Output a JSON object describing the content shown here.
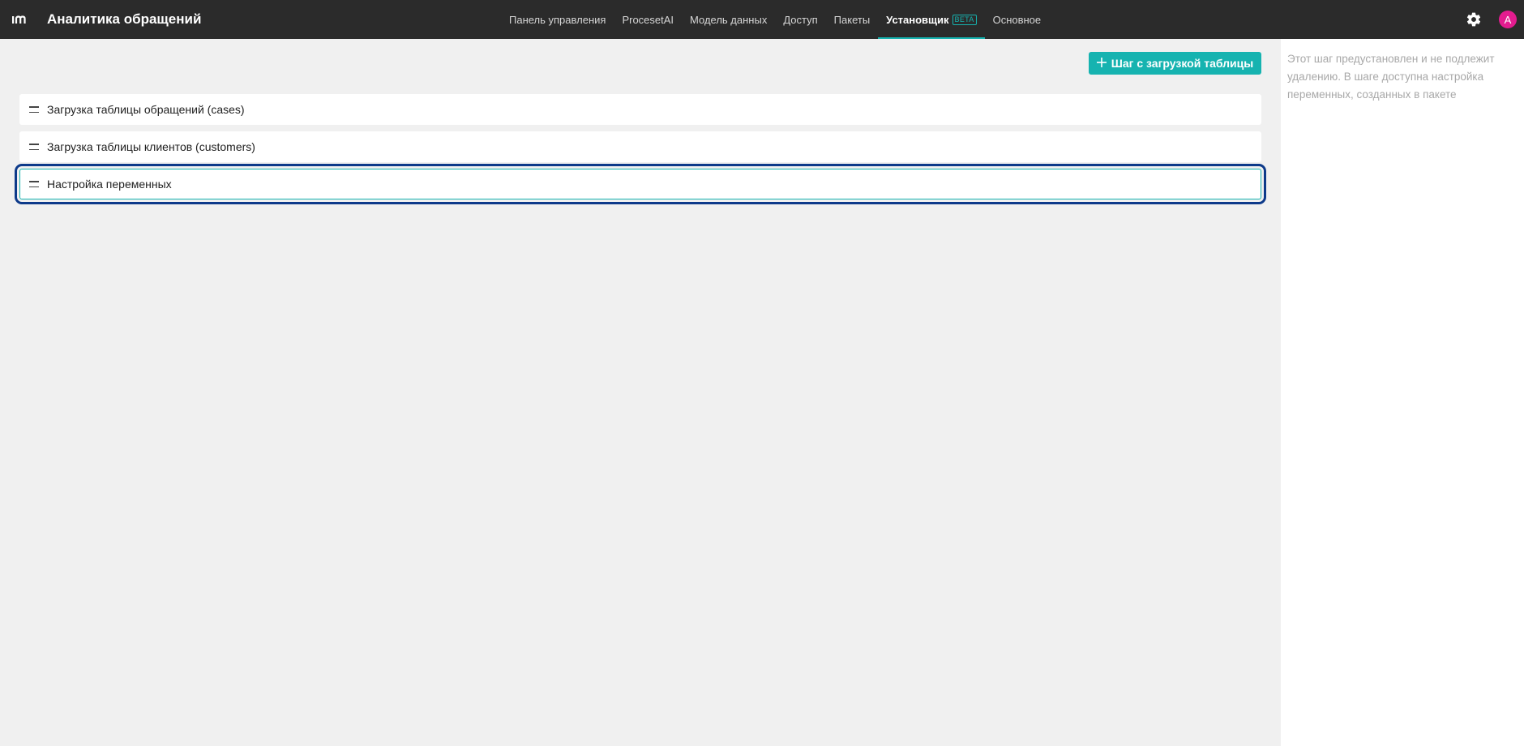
{
  "header": {
    "app_title": "Аналитика обращений",
    "logo_icon": "im-logo-icon",
    "tabs": [
      {
        "label": "Панель управления",
        "active": false
      },
      {
        "label": "ProcesetAI",
        "active": false
      },
      {
        "label": "Модель данных",
        "active": false
      },
      {
        "label": "Доступ",
        "active": false
      },
      {
        "label": "Пакеты",
        "active": false
      },
      {
        "label": "Установщик",
        "active": true,
        "badge": "BETA"
      },
      {
        "label": "Основное",
        "active": false
      }
    ],
    "settings_icon": "gear-icon",
    "avatar_letter": "A",
    "avatar_color": "#e31c8f"
  },
  "toolbar": {
    "add_step_label": "Шаг с загрузкой таблицы",
    "add_icon": "plus-icon"
  },
  "steps": [
    {
      "label": "Загрузка таблицы обращений (cases)",
      "selected": false
    },
    {
      "label": "Загрузка таблицы клиентов (customers)",
      "selected": false
    },
    {
      "label": "Настройка переменных",
      "selected": true
    }
  ],
  "side_panel": {
    "note": "Этот шаг предустановлен и не подлежит удалению. В шаге доступна настройка переменных, созданных в пакете"
  },
  "colors": {
    "accent": "#16b3b0",
    "topbar": "#2b2b2b",
    "selection_outline": "#0d3a8a"
  }
}
